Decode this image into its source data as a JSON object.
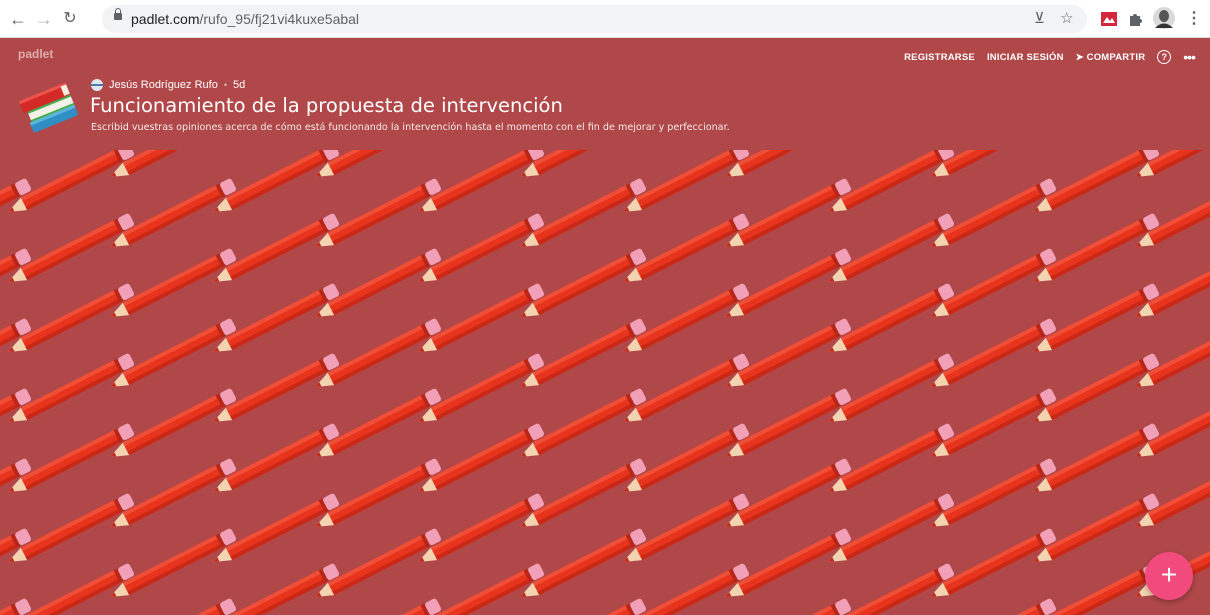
{
  "browser": {
    "url_host": "padlet.com",
    "url_path": "/rufo_95/fj21vi4kuxe5abal",
    "icons": [
      "back-arrow-icon",
      "forward-arrow-icon",
      "reload-icon",
      "lock-icon",
      "install-app-icon",
      "bookmark-star-icon",
      "extension-red-icon",
      "extensions-puzzle-icon",
      "profile-avatar-icon",
      "kebab-menu-icon"
    ]
  },
  "padlet": {
    "logo": "padlet",
    "nav": {
      "register": "REGISTRARSE",
      "login": "INICIAR SESIÓN",
      "share": "COMPARTIR"
    },
    "author": "Jesús Rodríguez Rufo",
    "separator": "•",
    "age": "5d",
    "title": "Funcionamiento de la propuesta de intervención",
    "subtitle": "Escribid vuestras opiniones acerca de cómo está funcionando la intervención hasta el momento con el fin de mejorar y perfeccionar.",
    "fab_label": "+",
    "colors": {
      "background": "#b0484a",
      "pencil_body": "#e8341c",
      "pencil_eraser": "#f2a0b8",
      "pencil_wood": "#f3d3b0",
      "fab": "#f24a7d"
    }
  }
}
